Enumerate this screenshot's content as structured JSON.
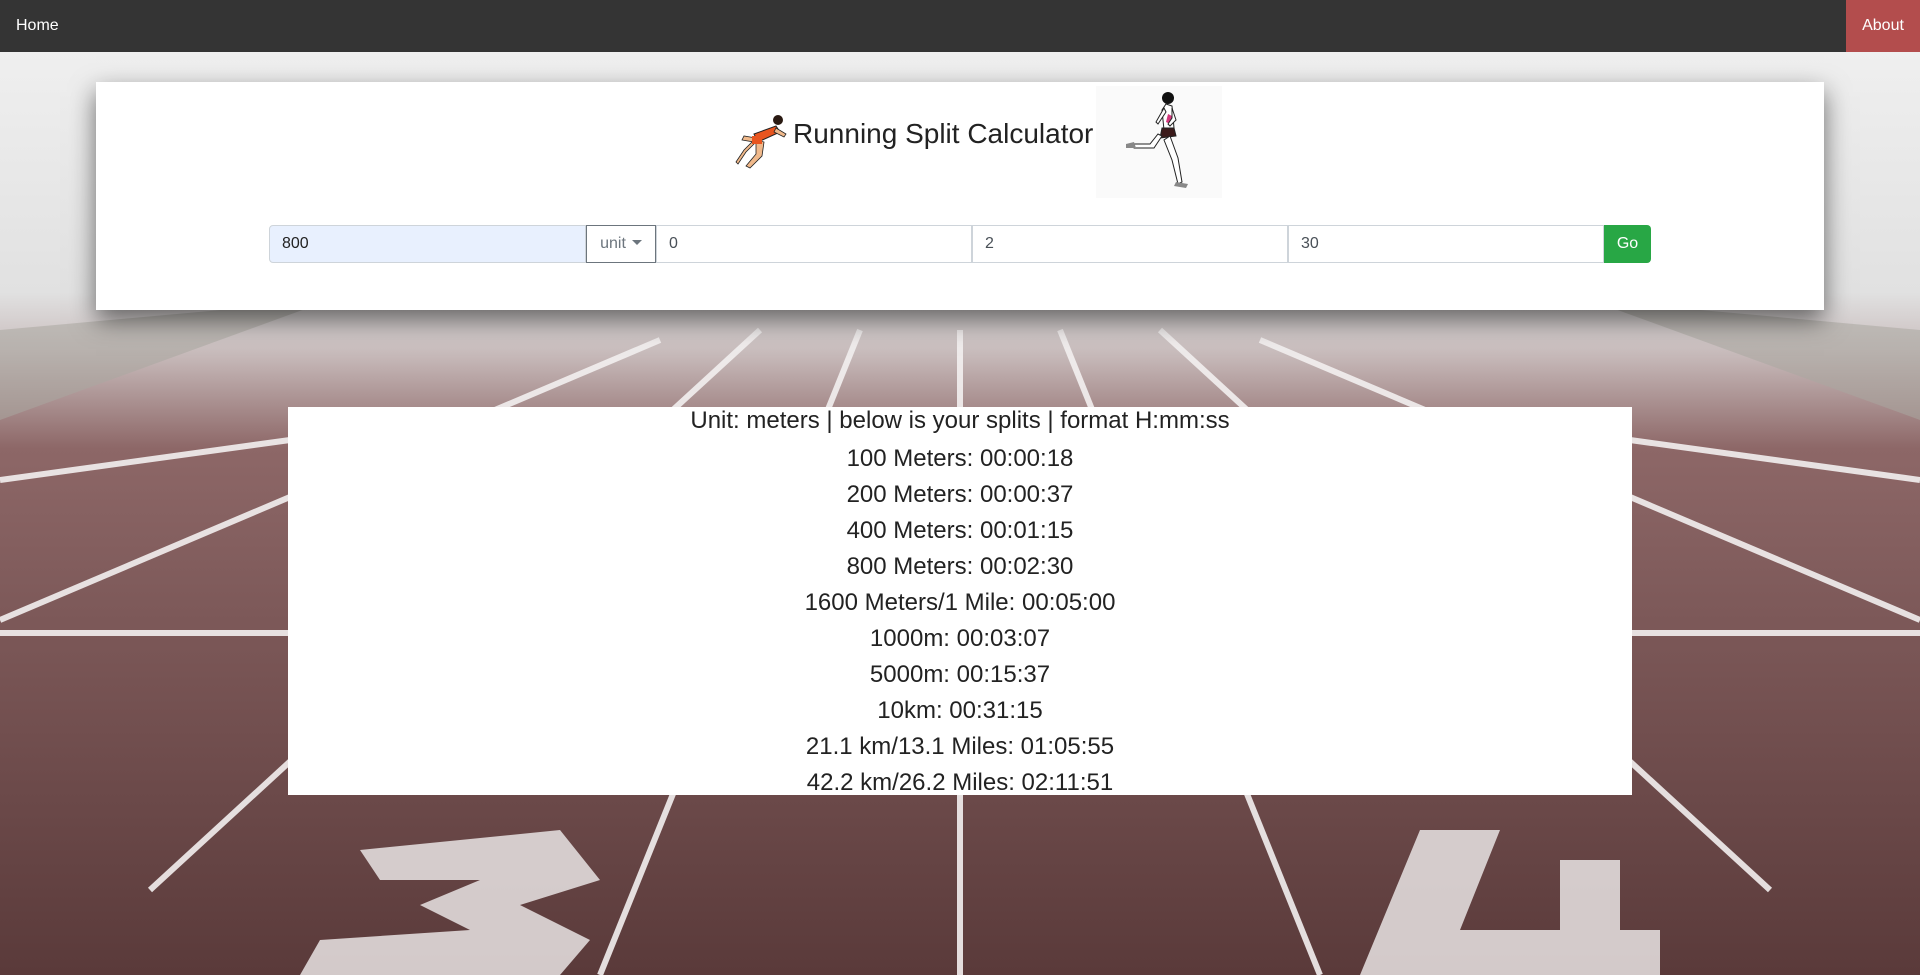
{
  "nav": {
    "home_label": "Home",
    "about_label": "About"
  },
  "header": {
    "title": "Running Split Calculator"
  },
  "form": {
    "distance_value": "800",
    "unit_label": "unit",
    "hours_value": "0",
    "minutes_value": "2",
    "seconds_value": "30",
    "go_label": "Go"
  },
  "results": {
    "summary": "Unit: meters | below is your splits | format H:mm:ss",
    "splits": [
      "100 Meters: 00:00:18",
      "200 Meters: 00:00:37",
      "400 Meters: 00:01:15",
      "800 Meters: 00:02:30",
      "1600 Meters/1 Mile: 00:05:00",
      "1000m: 00:03:07",
      "5000m: 00:15:37",
      "10km: 00:31:15",
      "21.1 km/13.1 Miles: 01:05:55",
      "42.2 km/26.2 Miles: 02:11:51"
    ]
  },
  "icons": {
    "sprinter_left": "sprinter-icon",
    "runner_right": "runner-icon",
    "unit_caret": "caret-down-icon"
  },
  "colors": {
    "navbar": "#343434",
    "about_button": "#b34d4d",
    "go_button": "#28a745",
    "distance_field_bg": "#e8f0fe"
  }
}
